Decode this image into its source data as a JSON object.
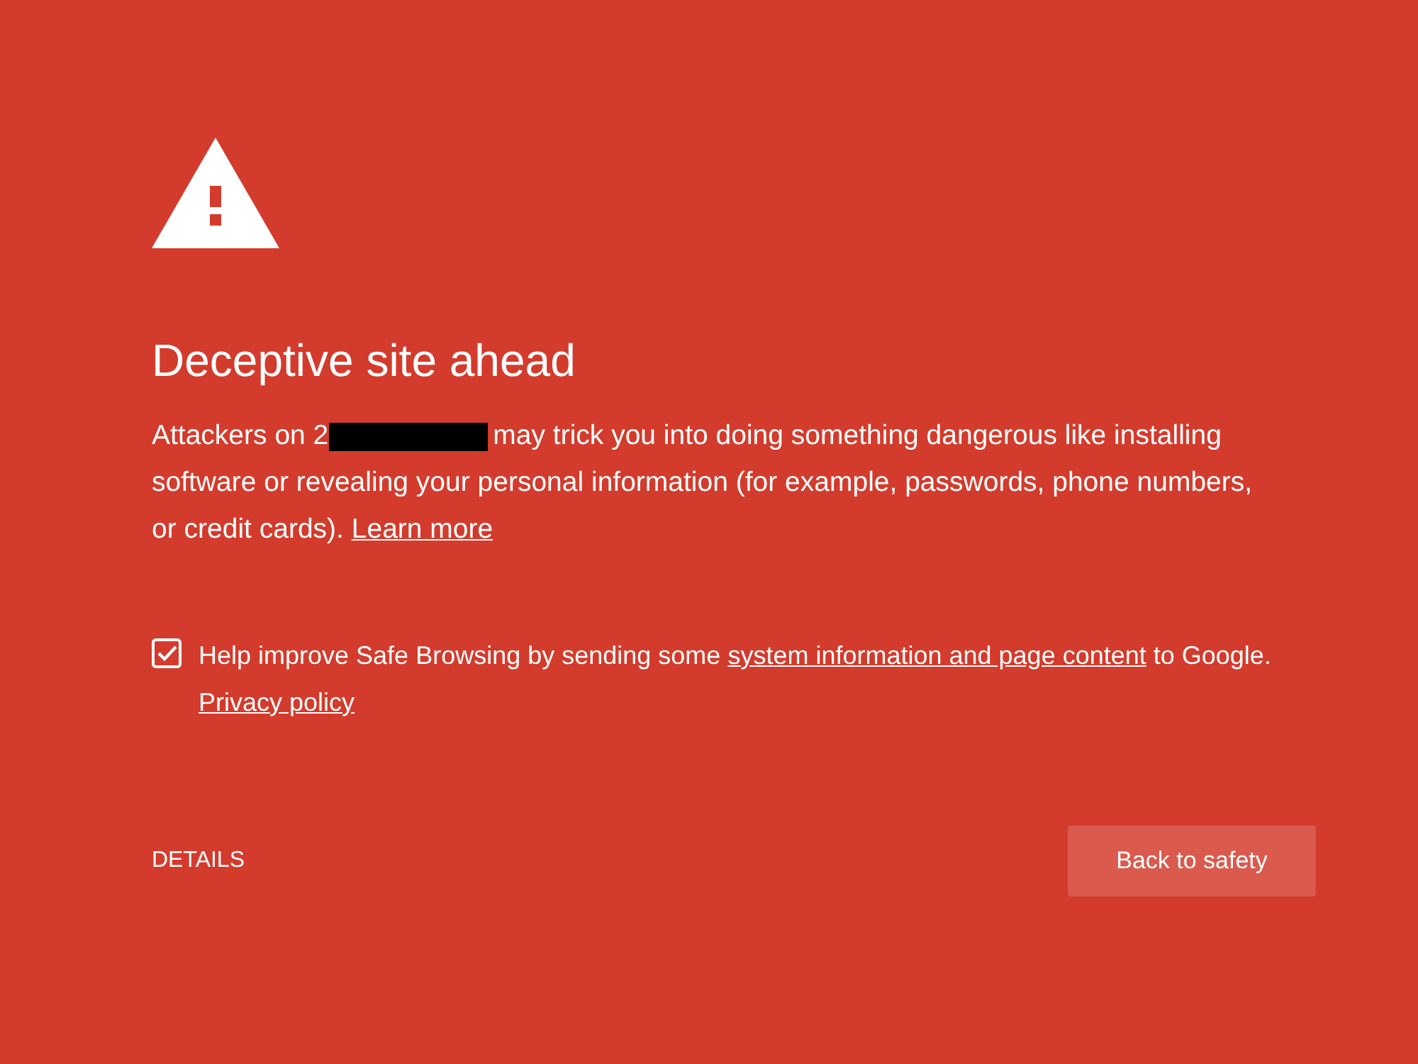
{
  "heading": "Deceptive site ahead",
  "message": {
    "text_before": "Attackers on 2",
    "redacted": true,
    "text_after": "may trick you into doing something dangerous like installing software or revealing your personal information (for example, passwords, phone numbers, or credit cards).",
    "link": "Learn more"
  },
  "report": {
    "checked": true,
    "text_before": "Help improve Safe Browsing by sending some",
    "link": "system information and page content",
    "text_after": "to Google.",
    "privacy_link": "Privacy policy"
  },
  "buttons": [
    {
      "kind": "link",
      "label": "DETAILS"
    },
    {
      "kind": "primary",
      "label": "Back to safety"
    }
  ]
}
